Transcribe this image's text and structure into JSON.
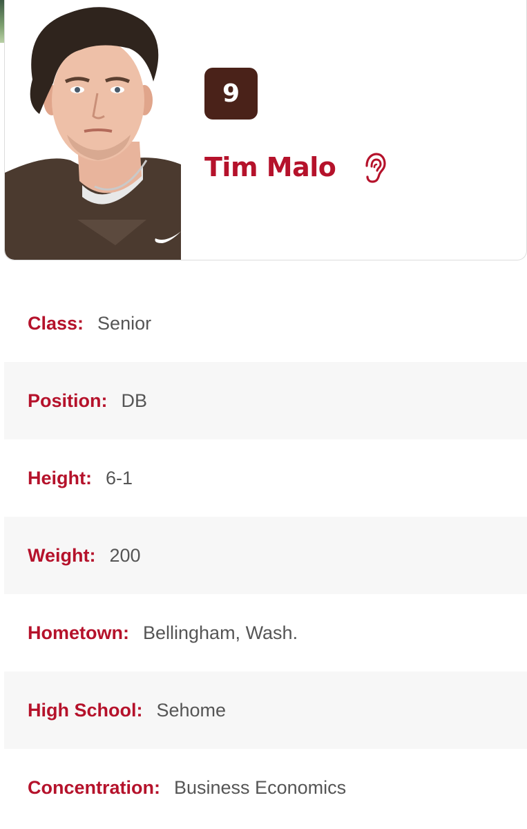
{
  "player": {
    "number": "9",
    "name": "Tim Malo",
    "photo_icon": "player-headshot",
    "listen_icon": "ear-icon"
  },
  "colors": {
    "accent": "#b5122b",
    "badge_bg": "#4a2219",
    "value_text": "#555555",
    "alt_row_bg": "#f7f7f7"
  },
  "details": [
    {
      "label": "Class:",
      "value": "Senior"
    },
    {
      "label": "Position:",
      "value": "DB"
    },
    {
      "label": "Height:",
      "value": "6-1"
    },
    {
      "label": "Weight:",
      "value": "200"
    },
    {
      "label": "Hometown:",
      "value": "Bellingham, Wash."
    },
    {
      "label": "High School:",
      "value": "Sehome"
    },
    {
      "label": "Concentration:",
      "value": "Business Economics"
    }
  ]
}
